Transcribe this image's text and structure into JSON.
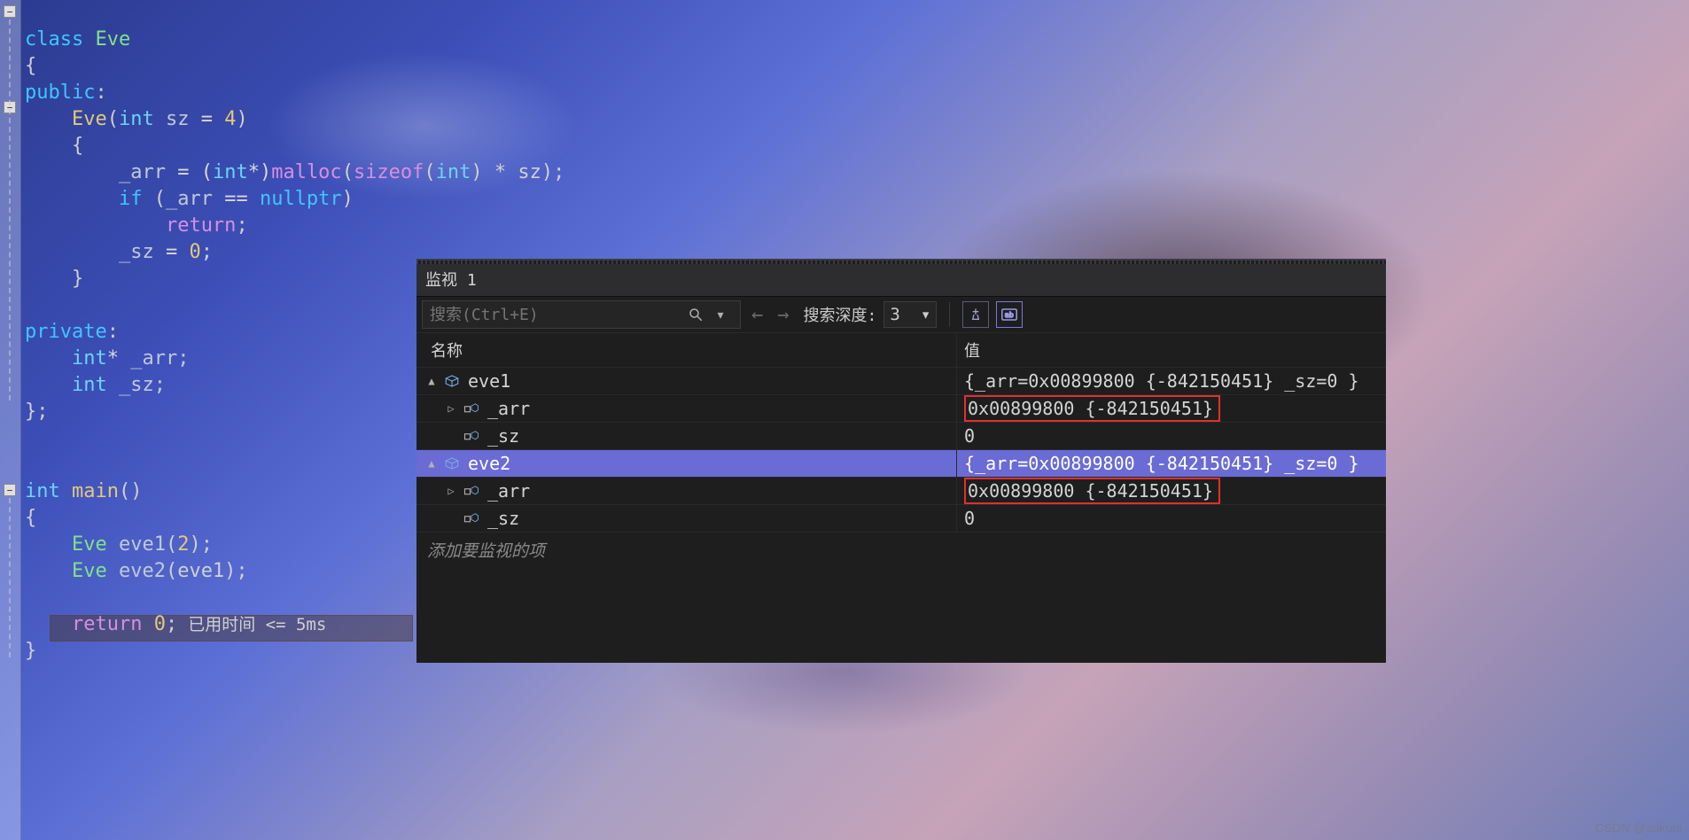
{
  "code": {
    "l1_class": "class",
    "l1_name": "Eve",
    "l2": "{",
    "l3_public": "public",
    "l3_colon": ":",
    "l4_ctor": "Eve",
    "l4_open": "(",
    "l4_int": "int",
    "l4_sz": " sz ",
    "l4_eq": "= ",
    "l4_num": "4",
    "l4_close": ")",
    "l5": "{",
    "l6_arr": "_arr ",
    "l6_eq": "= (",
    "l6_int": "int",
    "l6_ptr": "*)",
    "l6_malloc": "malloc",
    "l6_open": "(",
    "l6_sizeof": "sizeof",
    "l6_p": "(",
    "l6_int2": "int",
    "l6_p2": ") * sz);",
    "l7_if": "if ",
    "l7_open": "(",
    "l7_arr": "_arr ",
    "l7_eq": "== ",
    "l7_null": "nullptr",
    "l7_close": ")",
    "l8_return": "return",
    "l8_semi": ";",
    "l9_sz": "_sz ",
    "l9_eq": "= ",
    "l9_zero": "0",
    "l9_semi": ";",
    "l10": "}",
    "l12_private": "private",
    "l12_colon": ":",
    "l13_int": "int",
    "l13_star": "* ",
    "l13_arr": "_arr;",
    "l14_int": "int",
    "l14_sz": " _sz;",
    "l15": "};",
    "l18_int": "int",
    "l18_main": " main",
    "l18_p": "()",
    "l19": "{",
    "l20_eve": "Eve ",
    "l20_v": "eve1",
    "l20_p": "(",
    "l20_n": "2",
    "l20_c": ");",
    "l21_eve": "Eve ",
    "l21_v": "eve2",
    "l21_p": "(eve1);",
    "l23_return": "return ",
    "l23_zero": "0",
    "l23_semi": ";",
    "l23_hint": "已用时间 <= 5ms",
    "l24": "}"
  },
  "watch": {
    "title": "监视 1",
    "search_placeholder": "搜索(Ctrl+E)",
    "depth_label": "搜索深度:",
    "depth_value": "3",
    "col_name": "名称",
    "col_value": "值",
    "add_item": "添加要监视的项",
    "rows": [
      {
        "expand": "▲",
        "depth": 0,
        "icon": "obj",
        "name": "eve1",
        "value": "{_arr=0x00899800 {-842150451} _sz=0 }",
        "sel": false,
        "hl": false
      },
      {
        "expand": "▷",
        "depth": 1,
        "icon": "field",
        "name": "_arr",
        "value": "0x00899800 {-842150451}",
        "sel": false,
        "hl": true
      },
      {
        "expand": "",
        "depth": 1,
        "icon": "field",
        "name": "_sz",
        "value": "0",
        "sel": false,
        "hl": false
      },
      {
        "expand": "▲",
        "depth": 0,
        "icon": "obj",
        "name": "eve2",
        "value": "{_arr=0x00899800 {-842150451} _sz=0 }",
        "sel": true,
        "hl": false
      },
      {
        "expand": "▷",
        "depth": 1,
        "icon": "field",
        "name": "_arr",
        "value": "0x00899800 {-842150451}",
        "sel": false,
        "hl": true
      },
      {
        "expand": "",
        "depth": 1,
        "icon": "field",
        "name": "_sz",
        "value": "0",
        "sel": false,
        "hl": false
      }
    ]
  },
  "watermark": "CSDN @sukuni"
}
